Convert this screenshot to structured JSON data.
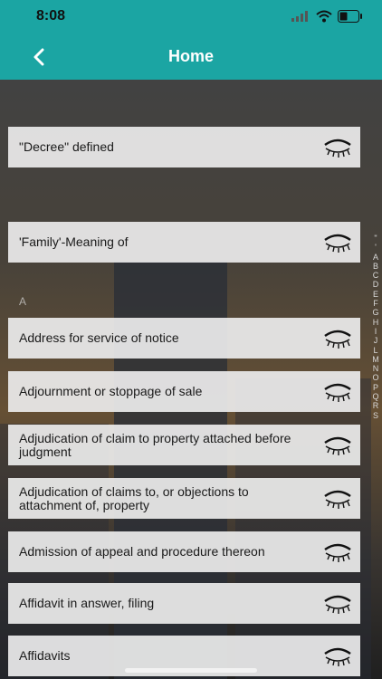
{
  "status": {
    "time": "8:08"
  },
  "nav": {
    "title": "Home",
    "back_icon": "chevron-left-icon"
  },
  "sections": [
    {
      "label": "",
      "items": [
        "\"Decree\" defined"
      ]
    },
    {
      "label": "",
      "items": [
        "'Family'-Meaning of"
      ]
    },
    {
      "label": "A",
      "items": [
        "Address for service of notice",
        "Adjournment or stoppage of sale",
        "Adjudication of claim to property attached before judgment",
        "Adjudication of claims to, or objections to attachment of, property",
        "Admission of appeal and procedure thereon",
        "Affidavit in answer, filing",
        "Affidavits"
      ]
    }
  ],
  "row_icon": "eye-closed-icon",
  "index_letters": [
    "\"",
    "'",
    "A",
    "B",
    "C",
    "D",
    "E",
    "F",
    "G",
    "H",
    "I",
    "J",
    "L",
    "M",
    "N",
    "O",
    "P",
    "Q",
    "R",
    "S"
  ],
  "colors": {
    "accent": "#1ba5a3",
    "row_bg": "#ebebeb"
  }
}
